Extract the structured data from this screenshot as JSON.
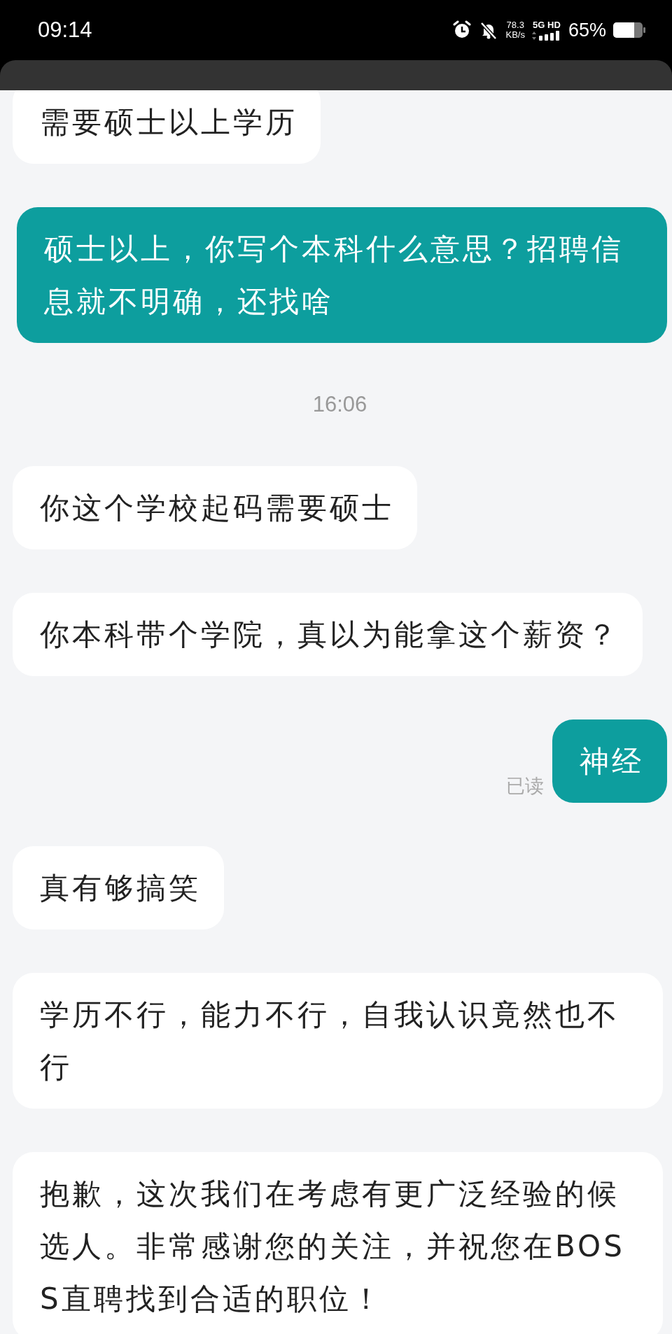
{
  "status_bar": {
    "time": "09:14",
    "speed_value": "78.3",
    "speed_unit": "KB/s",
    "network": "5G HD",
    "battery": "65%"
  },
  "messages": [
    {
      "kind": "received",
      "text": "需要硕士以上学历"
    },
    {
      "kind": "sent",
      "text": "硕士以上，你写个本科什么意思？招聘信息就不明确，还找啥"
    },
    {
      "kind": "time",
      "text": "16:06"
    },
    {
      "kind": "received",
      "text": "你这个学校起码需要硕士"
    },
    {
      "kind": "received",
      "text": "你本科带个学院，真以为能拿这个薪资？"
    },
    {
      "kind": "sent",
      "text": "神经",
      "receipt": "已读"
    },
    {
      "kind": "received",
      "text": "真有够搞笑"
    },
    {
      "kind": "received",
      "text": "学历不行，能力不行，自我认识竟然也不行"
    },
    {
      "kind": "received",
      "text": "抱歉，这次我们在考虑有更广泛经验的候选人。非常感谢您的关注，并祝您在BOSS直聘找到合适的职位！"
    }
  ]
}
